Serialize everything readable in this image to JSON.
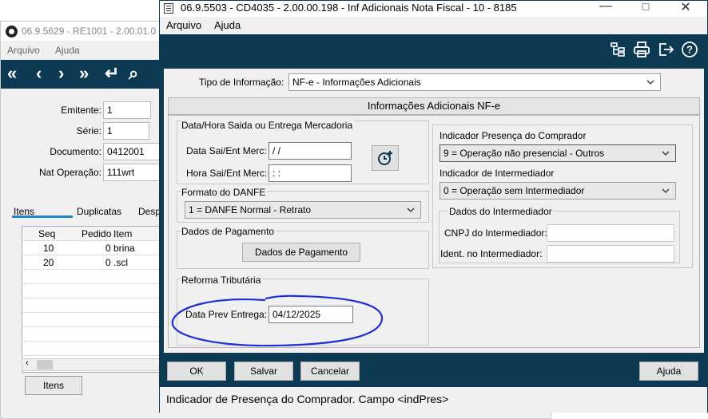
{
  "bg_window": {
    "title": "06.9.5629 - RE1001 - 2.00.01.0",
    "menu": [
      "Arquivo",
      "Ajuda"
    ],
    "toolbar_icons": [
      "double-left-icon",
      "left-icon",
      "right-icon",
      "double-right-icon",
      "return-icon",
      "search-icon"
    ],
    "fields": [
      {
        "label": "Emitente:",
        "value": "1"
      },
      {
        "label": "Série:",
        "value": "1"
      },
      {
        "label": "Documento:",
        "value": "0412001"
      },
      {
        "label": "Nat Operação:",
        "value": "111wrt"
      }
    ],
    "tabs": [
      "Itens",
      "Duplicatas",
      "Desp"
    ],
    "grid": {
      "columns": [
        "Seq",
        "Pedido",
        "Item"
      ],
      "rows": [
        [
          "10",
          "0",
          "brina"
        ],
        [
          "20",
          "0",
          ".scl"
        ]
      ]
    },
    "itens_button": "Itens"
  },
  "dialog": {
    "title": "06.9.5503 - CD4035 - 2.00.00.198 - Inf Adicionais Nota Fiscal - 10 - 8185",
    "menu": [
      "Arquivo",
      "Ajuda"
    ],
    "toolbar_icons": [
      "hierarchy-icon",
      "print-icon",
      "exit-icon",
      "help-icon"
    ],
    "tipo_label": "Tipo de Informação:",
    "tipo_value": "NF-e - Informações Adicionais",
    "panel_title": "Informações Adicionais NF-e",
    "datahora": {
      "group_title": "Data/Hora Saida ou Entrega Mercadoria",
      "data_label": "Data Sai/Ent Merc:",
      "data_value": " / /",
      "hora_label": "Hora Sai/Ent Merc:",
      "hora_value": " :  :"
    },
    "formato": {
      "group_title": "Formato do DANFE",
      "value": "1 = DANFE Normal - Retrato"
    },
    "pagamento": {
      "group_title": "Dados de Pagamento",
      "button": "Dados de Pagamento"
    },
    "reforma": {
      "group_title": "Reforma Tributária",
      "label": "Data Prev Entrega:",
      "value": "04/12/2025"
    },
    "presenca": {
      "label": "Indicador Presença do Comprador",
      "value": "9 = Operação não presencial - Outros"
    },
    "intermediador": {
      "label": "Indicador de Intermediador",
      "value": "0 = Operação sem Intermediador",
      "group_title": "Dados do Intermediador",
      "cnpj_label": "CNPJ do Intermediador:",
      "ident_label": "Ident. no Intermediador:"
    },
    "buttons": {
      "ok": "OK",
      "salvar": "Salvar",
      "cancelar": "Cancelar",
      "ajuda": "Ajuda"
    },
    "status": "Indicador de Presença do Comprador. Campo <indPres>"
  },
  "colors": {
    "toolbar_bg": "#0b3a52",
    "annotation": "#1f2fd6",
    "tab_underline": "#1e88c8"
  }
}
